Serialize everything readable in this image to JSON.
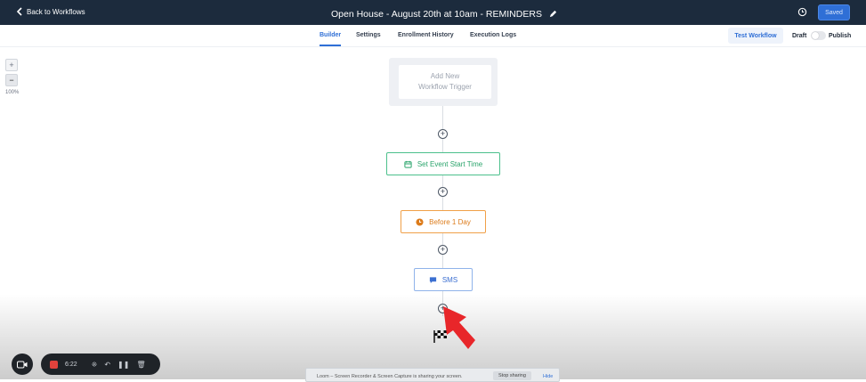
{
  "topbar": {
    "back_label": "Back to Workflows",
    "title": "Open House - August 20th at 10am - REMINDERS",
    "saved_label": "Saved"
  },
  "tabs": [
    {
      "label": "Builder",
      "active": true
    },
    {
      "label": "Settings",
      "active": false
    },
    {
      "label": "Enrollment History",
      "active": false
    },
    {
      "label": "Execution Logs",
      "active": false
    }
  ],
  "actions": {
    "test_label": "Test Workflow",
    "draft_label": "Draft",
    "publish_label": "Publish",
    "publish_toggle_on": false
  },
  "zoom": {
    "in_label": "+",
    "out_label": "−",
    "level": "100%"
  },
  "workflow": {
    "trigger_label_line1": "Add New",
    "trigger_label_line2": "Workflow Trigger",
    "nodes": [
      {
        "label": "Set Event Start Time",
        "icon": "calendar-icon",
        "color": "#2aa46b"
      },
      {
        "label": "Before 1 Day",
        "icon": "clock-icon",
        "color": "#dc7b1a"
      },
      {
        "label": "SMS",
        "icon": "message-icon",
        "color": "#3b6fd1"
      }
    ],
    "add_symbol": "+"
  },
  "recorder": {
    "time": "6:22"
  },
  "share_banner": {
    "text": "Loom – Screen Recorder & Screen Capture is sharing your screen.",
    "stop_label": "Stop sharing",
    "hide_label": "Hide"
  },
  "colors": {
    "topbar": "#1c2b3d",
    "accent": "#2f6fd6",
    "recording": "#e0423c",
    "pointer": "#e8262a"
  }
}
